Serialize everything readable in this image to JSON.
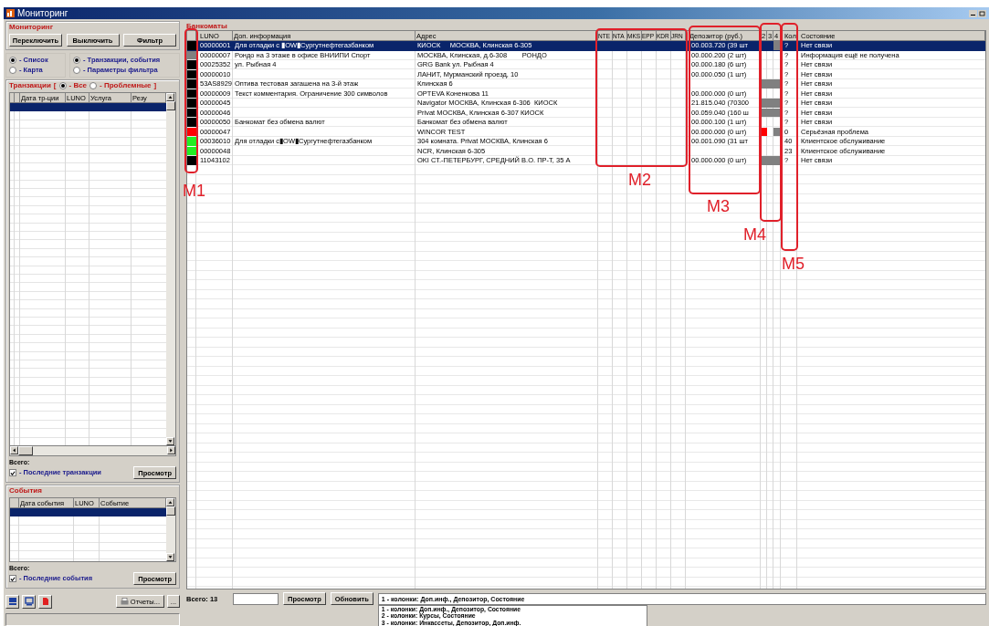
{
  "window": {
    "title": "Мониторинг"
  },
  "monitoring": {
    "title": "Мониторинг",
    "buttons": [
      "Переключить",
      "Выключить",
      "Фильтр"
    ],
    "view_options": [
      {
        "label": "- Список",
        "selected": true
      },
      {
        "label": "- Карта",
        "selected": false
      }
    ],
    "content_options": [
      {
        "label": "- Транзакции, события",
        "selected": true
      },
      {
        "label": "- Параметры фильтра",
        "selected": false
      }
    ]
  },
  "transactions": {
    "title": "Транзакции",
    "bracket_open": "[",
    "bracket_close": "]",
    "filters": [
      {
        "label": "- Все",
        "selected": true
      },
      {
        "label": "- Проблемные",
        "selected": false
      }
    ],
    "columns": [
      "Дата тр-ции",
      "LUNO",
      "Услуга",
      "Резу"
    ],
    "total_label": "Всего:",
    "recent": {
      "label": "- Последние транзакции",
      "checked": true
    },
    "view_button": "Просмотр"
  },
  "events": {
    "title": "События",
    "columns": [
      "Дата события",
      "LUNO",
      "Событие"
    ],
    "total_label": "Всего:",
    "recent": {
      "label": "- Последние события",
      "checked": true
    },
    "view_button": "Просмотр"
  },
  "tools": {
    "reports_button": "Отчеты...",
    "more_button": "..."
  },
  "atms": {
    "title": "Банкоматы",
    "columns": [
      "LUNO",
      "Доп. информация",
      "Адрес",
      "NTE",
      "NTA",
      "MKS",
      "EPP",
      "KDR",
      "JRN",
      "Депозитор (руб.)",
      "2",
      "3",
      "4",
      "Кол",
      "Состояние"
    ],
    "rows": [
      {
        "color": "#000000",
        "luno": "00000001",
        "info": "Для отладки с ▮OW▮Сургутнефтегазбанком",
        "address": "КИОСК     МОСКВА, Клинская 6-305",
        "deposit": "00.003.720 (39 шт",
        "indicators": [
          {
            "filled": false
          },
          {
            "filled": false
          },
          {
            "filled": true,
            "color": "#808080"
          }
        ],
        "count": "?",
        "state": "Нет связи",
        "selected": true
      },
      {
        "color": "#808080",
        "luno": "00000007",
        "info": "Рондо на 3 этаже в офисе ВНИИПИ Спорт",
        "address": "МОСКВА, Клинская, д.6-308        РОНДО",
        "deposit": "00.000.200 (2 шт)",
        "indicators": [
          {
            "filled": false
          },
          {
            "filled": false
          },
          {
            "filled": false
          }
        ],
        "count": "?",
        "state": "Информация ещё не получена",
        "selected": false
      },
      {
        "color": "#000000",
        "luno": "00025352",
        "info": "ул. Рыбная 4",
        "address": "GRG Bank ул. Рыбная 4",
        "deposit": "00.000.180 (6 шт)",
        "indicators": [
          {
            "filled": false
          },
          {
            "filled": false
          },
          {
            "filled": false
          }
        ],
        "count": "?",
        "state": "Нет связи",
        "selected": false
      },
      {
        "color": "#000000",
        "luno": "00000010",
        "address": "ЛАНИТ, Мурманский проезд, 10",
        "deposit": "00.000.050 (1 шт)",
        "indicators": [
          {
            "filled": false
          },
          {
            "filled": false
          },
          {
            "filled": false
          }
        ],
        "count": "?",
        "state": "Нет связи",
        "selected": false
      },
      {
        "color": "#000000",
        "luno": "53AS8929",
        "info": "Оптива тестовая загашена на 3-й этаж",
        "address": "Клинская 6",
        "indicators": [
          {
            "filled": true,
            "color": "#808080"
          },
          {
            "filled": true,
            "color": "#808080"
          },
          {
            "filled": true,
            "color": "#808080"
          }
        ],
        "count": "?",
        "state": "Нет связи",
        "selected": false
      },
      {
        "color": "#000000",
        "luno": "00000009",
        "info": "Текст комментария. Ограничение 300 символов",
        "address": "OPTEVA Коненкова 11",
        "deposit": "00.000.000 (0 шт)",
        "indicators": [
          {
            "filled": false
          },
          {
            "filled": false
          },
          {
            "filled": false
          }
        ],
        "count": "?",
        "state": "Нет связи",
        "selected": false
      },
      {
        "color": "#000000",
        "luno": "00000045",
        "address": "Navigator МОСКВА, Клинская 6-306  КИОСК",
        "deposit": "21.815.040 (70300",
        "indicators": [
          {
            "filled": true,
            "color": "#808080"
          },
          {
            "filled": true,
            "color": "#808080"
          },
          {
            "filled": true,
            "color": "#808080"
          }
        ],
        "count": "?",
        "state": "Нет связи",
        "selected": false
      },
      {
        "color": "#000000",
        "luno": "00000046",
        "address": "Privat МОСКВА, Клинская 6-307 КИОСК",
        "deposit": "00.059.040 (160 ш",
        "indicators": [
          {
            "filled": true,
            "color": "#808080"
          },
          {
            "filled": true,
            "color": "#808080"
          },
          {
            "filled": true,
            "color": "#808080"
          }
        ],
        "count": "?",
        "state": "Нет связи",
        "selected": false
      },
      {
        "color": "#000000",
        "luno": "00000050",
        "info": "Банкомат без обмена валют",
        "address": "Банкомат без обмена валют",
        "deposit": "00.000.100 (1 шт)",
        "indicators": [
          {
            "filled": false
          },
          {
            "filled": false
          },
          {
            "filled": false
          }
        ],
        "count": "?",
        "state": "Нет связи",
        "selected": false
      },
      {
        "color": "#ff0000",
        "luno": "00000047",
        "address": "WINCOR TEST",
        "deposit": "00.000.000 (0 шт)",
        "indicators": [
          {
            "filled": true,
            "color": "#ff0000"
          },
          {
            "filled": false
          },
          {
            "filled": true,
            "color": "#808080"
          }
        ],
        "count": "0",
        "state": "Серьёзная проблема",
        "selected": false
      },
      {
        "color": "#22ee22",
        "luno": "00036010",
        "info": "Для отладки с▮OW▮Сургутнефтегазбанком",
        "address": "304 комната. Privat МОСКВА, Клинская 6",
        "deposit": "00.001.090 (31 шт",
        "indicators": [
          {
            "filled": false
          },
          {
            "filled": false
          },
          {
            "filled": false
          }
        ],
        "count": "40",
        "state": "Клиентское обслуживание",
        "selected": false
      },
      {
        "color": "#22ee22",
        "luno": "00000048",
        "address": "NCR, Клинская 6-305",
        "indicators": [
          {
            "filled": false
          },
          {
            "filled": false
          },
          {
            "filled": false
          }
        ],
        "count": "23",
        "state": "Клиентское обслуживание",
        "selected": false
      },
      {
        "color": "#000000",
        "luno": "11043102",
        "address": "OKI СТ.-ПЕТЕРБУРГ, СРЕДНИЙ В.О. ПР-Т, 35 А",
        "deposit": "00.000.000 (0 шт)",
        "indicators": [
          {
            "filled": true,
            "color": "#808080"
          },
          {
            "filled": true,
            "color": "#808080"
          },
          {
            "filled": true,
            "color": "#808080"
          }
        ],
        "count": "?",
        "state": "Нет связи",
        "selected": false
      }
    ]
  },
  "bottom": {
    "total": "Всего: 13",
    "buttons": [
      "Просмотр",
      "Обновить"
    ],
    "layout_select": {
      "value": "1 - колонки: Доп.инф., Депозитор, Состояние",
      "options": [
        "1 - колонки: Доп.инф., Депозитор, Состояние",
        "2 - колонки: Курсы, Состояние",
        "3 - колонки: Инкассеты, Депозитор, Доп.инф."
      ]
    }
  },
  "annotations": [
    {
      "label": "M1"
    },
    {
      "label": "M2"
    },
    {
      "label": "M3"
    },
    {
      "label": "M4"
    },
    {
      "label": "M5"
    }
  ]
}
